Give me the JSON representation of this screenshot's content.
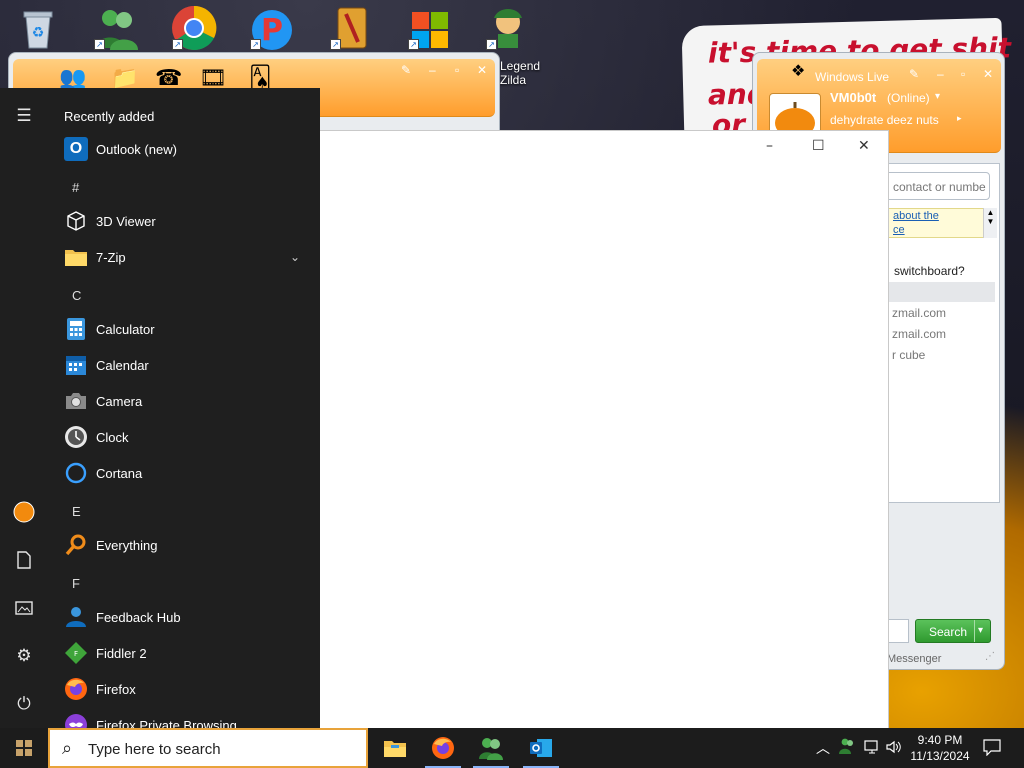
{
  "desktop": {
    "icons": [
      {
        "name": "Recycle Bin",
        "icon": "recycle-bin-icon"
      },
      {
        "name": "Messenger",
        "icon": "messenger-icon"
      },
      {
        "name": "Google Chrome",
        "icon": "chrome-icon"
      },
      {
        "name": "Pidgin",
        "icon": "p-app-icon"
      },
      {
        "name": "Winamp",
        "icon": "winamp-icon"
      },
      {
        "name": "Windows",
        "icon": "windows-logo-icon"
      },
      {
        "name": "Legend of Zilda",
        "icon": "zelda-game-icon",
        "label_line1": "Legend",
        "label_line2": "Zilda"
      }
    ],
    "wallpaper_text": {
      "line1": "it's time to get shit",
      "line2": "and",
      "line3": "or t"
    }
  },
  "messenger_left": {
    "menu_icons": [
      "buddy-icon",
      "folder-icon",
      "phone-icon",
      "film-icon",
      "cards-icon"
    ]
  },
  "messenger_right": {
    "title": "Windows Live",
    "display_name": "VM0b0t",
    "status": "(Online)",
    "personal_message": "dehydrate deez nuts",
    "search_placeholder": "contact or numbe",
    "news_line1": "about the",
    "news_line2": "ce",
    "question": "switchboard?",
    "contacts": [
      "zmail.com",
      "zmail.com",
      "r cube"
    ],
    "search_button": "Search",
    "footer": "Messenger"
  },
  "blank_window": {
    "minimize": "–",
    "maximize": "☐",
    "close": "✕"
  },
  "start_menu": {
    "recently_added": "Recently added",
    "items": [
      {
        "type": "app",
        "label": "Outlook (new)",
        "icon": "outlook-icon"
      },
      {
        "type": "header",
        "label": "#"
      },
      {
        "type": "app",
        "label": "3D Viewer",
        "icon": "cube-icon"
      },
      {
        "type": "app",
        "label": "7-Zip",
        "icon": "folder-icon",
        "expandable": true
      },
      {
        "type": "header",
        "label": "C"
      },
      {
        "type": "app",
        "label": "Calculator",
        "icon": "calculator-icon"
      },
      {
        "type": "app",
        "label": "Calendar",
        "icon": "calendar-icon"
      },
      {
        "type": "app",
        "label": "Camera",
        "icon": "camera-icon"
      },
      {
        "type": "app",
        "label": "Clock",
        "icon": "clock-icon"
      },
      {
        "type": "app",
        "label": "Cortana",
        "icon": "cortana-icon"
      },
      {
        "type": "header",
        "label": "E"
      },
      {
        "type": "app",
        "label": "Everything",
        "icon": "search-magnifier-icon"
      },
      {
        "type": "header",
        "label": "F"
      },
      {
        "type": "app",
        "label": "Feedback Hub",
        "icon": "feedback-hub-icon"
      },
      {
        "type": "app",
        "label": "Fiddler 2",
        "icon": "fiddler-icon"
      },
      {
        "type": "app",
        "label": "Firefox",
        "icon": "firefox-icon"
      },
      {
        "type": "app",
        "label": "Firefox Private Browsing",
        "icon": "firefox-private-icon"
      }
    ],
    "rail": [
      "hamburger-icon",
      "user-avatar-icon",
      "documents-icon",
      "pictures-icon",
      "settings-icon",
      "power-icon"
    ]
  },
  "taskbar": {
    "search_placeholder": "Type here to search",
    "pinned": [
      "file-explorer-icon",
      "firefox-icon",
      "messenger-icon",
      "outlook-icon"
    ],
    "tray": [
      "chevron-up-icon",
      "messenger-tray-icon",
      "network-icon",
      "volume-icon"
    ],
    "time": "9:40 PM",
    "date": "11/13/2024",
    "notification_icon": "notification-icon"
  }
}
